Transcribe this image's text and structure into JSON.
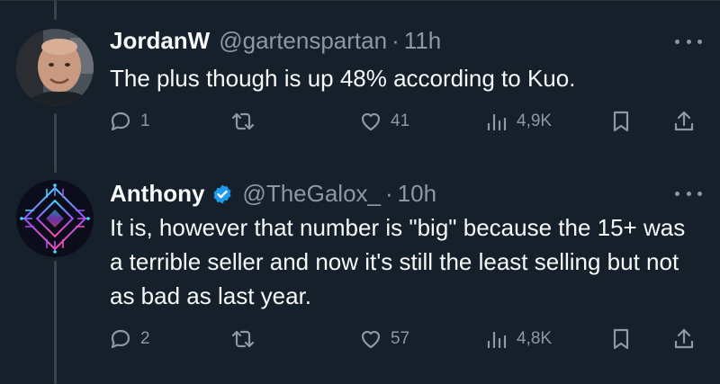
{
  "tweets": [
    {
      "name": "JordanW",
      "handle": "@gartenspartan",
      "separator": "·",
      "time": "11h",
      "verified": false,
      "text": "The plus though is up 48% according to Kuo.",
      "replies": "1",
      "retweets": "",
      "likes": "41",
      "views": "4,9K"
    },
    {
      "name": "Anthony",
      "handle": "@TheGalox_",
      "separator": "·",
      "time": "10h",
      "verified": true,
      "text": "It is, however that number is \"big\" because the 15+ was a terrible seller and now it's still the least selling but not as bad as last year.",
      "replies": "2",
      "retweets": "",
      "likes": "57",
      "views": "4,8K"
    }
  ],
  "colors": {
    "background": "#15202b",
    "secondary_text": "#8b98a5",
    "verified_blue": "#1d9bf0",
    "thread_line": "#38444d"
  },
  "icons": [
    "reply-icon",
    "retweet-icon",
    "like-icon",
    "views-icon",
    "bookmark-icon",
    "share-icon",
    "more-icon",
    "verified-badge-icon"
  ]
}
